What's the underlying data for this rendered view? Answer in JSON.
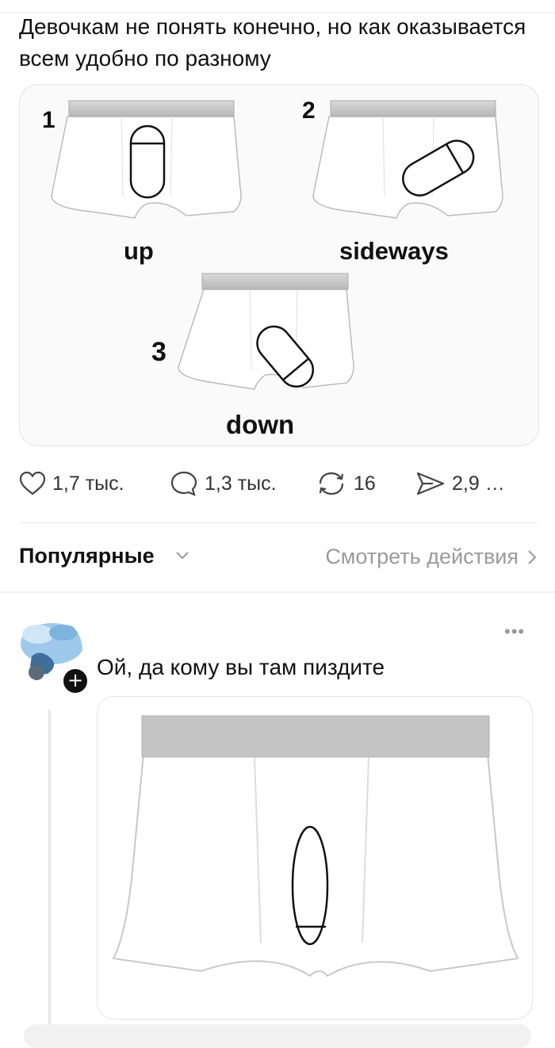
{
  "post": {
    "text": "Девочкам не понять конечно, но как оказывается всем удобно по разному",
    "image": {
      "panels": [
        {
          "number": "1",
          "label": "up"
        },
        {
          "number": "2",
          "label": "sideways"
        },
        {
          "number": "3",
          "label": "down"
        }
      ]
    },
    "actions": {
      "likes": "1,7 тыс.",
      "comments": "1,3 тыс.",
      "reposts": "16",
      "views": "2,9 …"
    }
  },
  "comments_header": {
    "sort_label": "Популярные",
    "view_actions_label": "Смотреть действия"
  },
  "reply": {
    "text": "Ой, да кому вы там пиздите",
    "badge": "+"
  },
  "icons": {
    "like": "heart-icon",
    "comment": "comment-bubble-icon",
    "repost": "repost-icon",
    "views": "share-arrow-icon",
    "more": "more-dots-icon"
  },
  "colors": {
    "text": "#111111",
    "muted": "#9a9a9a",
    "underwear_band": "#c8c8c8",
    "accent_badge": "#111111"
  }
}
